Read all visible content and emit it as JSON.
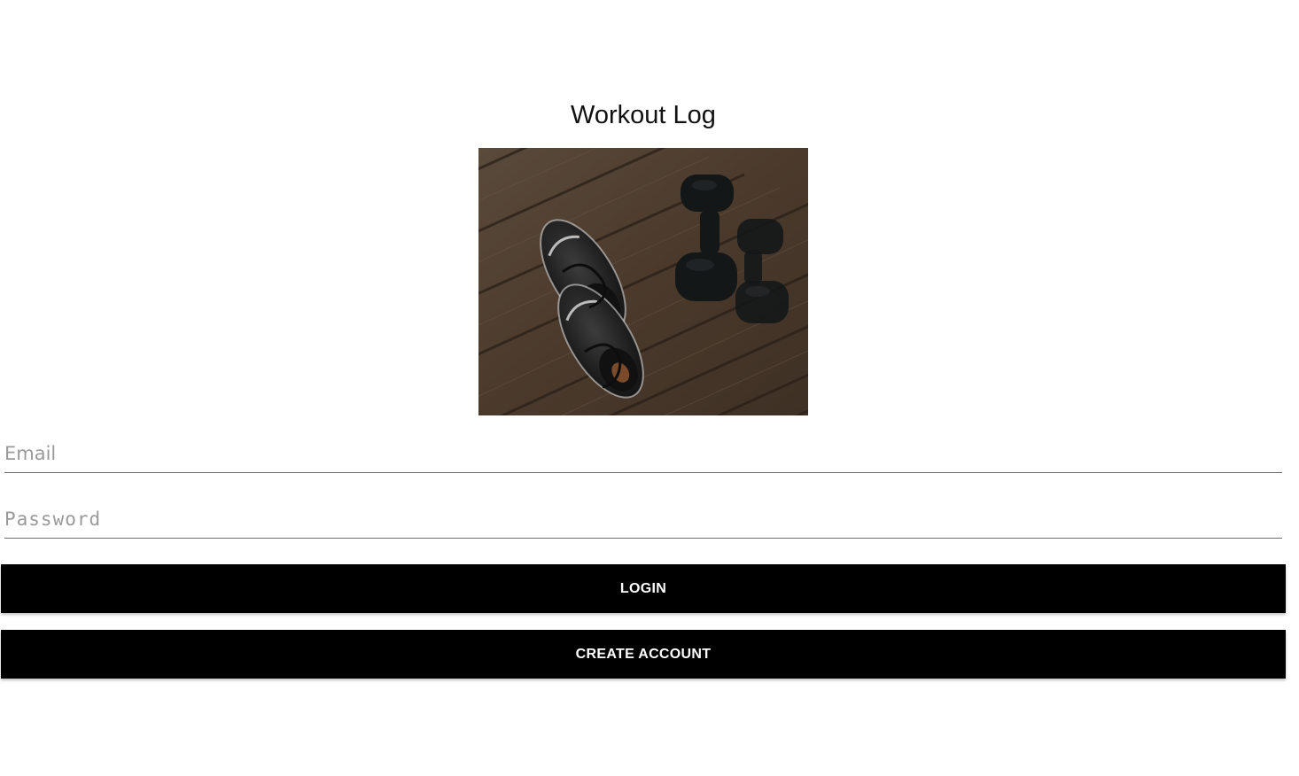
{
  "app": {
    "title": "Workout Log"
  },
  "hero_image": {
    "description_icon": "sneakers-and-dumbbells-image"
  },
  "form": {
    "email_placeholder": "Email",
    "email_value": "",
    "password_placeholder": "Password",
    "password_value": ""
  },
  "buttons": {
    "login_label": "LOGIN",
    "create_account_label": "CREATE ACCOUNT"
  },
  "colors": {
    "background": "#ffffff",
    "button_bg": "#000000",
    "button_text": "#ffffff",
    "underline": "#6d6d6d",
    "placeholder": "#9a9a9a"
  }
}
